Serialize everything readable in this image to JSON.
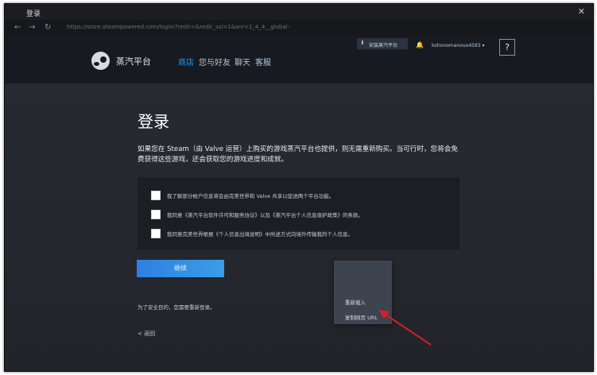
{
  "window": {
    "title": "登录",
    "close_glyph": "✕"
  },
  "addressbar": {
    "back_glyph": "←",
    "forward_glyph": "→",
    "reload_glyph": "↻",
    "url": "https://store.steampowered.com/login/?redir=&redir_ssl=1&snr=1_4_4__global-header"
  },
  "header": {
    "brand": "蒸汽平台",
    "nav": [
      "商店",
      "您与好友",
      "聊天",
      "客服"
    ],
    "install_label": "安装蒸汽平台",
    "account_label": "kohonomanouo4583",
    "account_caret": "▾",
    "help_label": "?"
  },
  "main": {
    "title": "登录",
    "intro": "如果您在 Steam（由 Valve 运营）上购买的游戏蒸汽平台也提供，则无需重新购买。当可行时，您将会免费获得这些游戏，还会获取您的游戏进度和成就。",
    "consent": [
      {
        "label": "我了解部分帐户信息将会由完美世界和 Valve 共享以促进两个平台功能。",
        "checked": false
      },
      {
        "label": "我同意《蒸汽平台软件许可和服务协议》以及《蒸汽平台个人信息保护政策》的条款。",
        "checked": false
      },
      {
        "label": "我同意完美世界根据《个人信息出境说明》中所述方式向境外传输我的个人信息。",
        "checked": false
      }
    ],
    "continue_label": "继续",
    "note": "为了安全目的，您需要重新登录。",
    "back_label": "< 返回"
  },
  "context_menu": {
    "items": [
      "重新载入",
      "复制网页 URL"
    ]
  },
  "colors": {
    "accent": "#1a9fff",
    "button": "#3a8fe3",
    "annotation_arrow": "#d3202a"
  }
}
